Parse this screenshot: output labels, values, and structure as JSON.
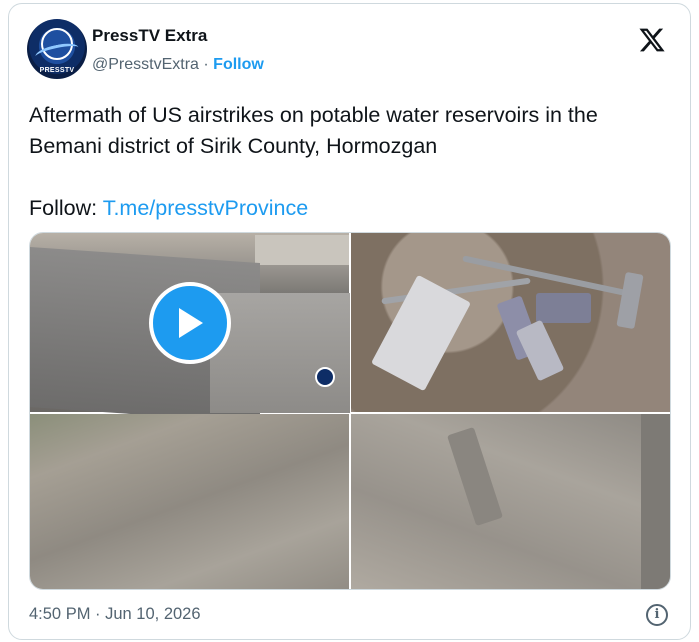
{
  "account": {
    "name": "PressTV Extra",
    "handle": "@PresstvExtra",
    "separator": "·",
    "follow_label": "Follow",
    "avatar_label": "PRESSTV"
  },
  "platform_icon": "x-logo-icon",
  "tweet": {
    "text_line": "Aftermath of US airstrikes on potable water reservoirs in the Bemani district of Sirik County, Hormozgan",
    "follow_prefix": "Follow: ",
    "follow_link": "T.me/presstvProvince"
  },
  "media": {
    "play_icon": "play-icon",
    "watermark_icon": "presstv-logo-icon"
  },
  "footer": {
    "timestamp": "4:50 PM · Jun 10, 2026",
    "info_icon": "info-icon",
    "info_glyph": "i"
  },
  "colors": {
    "accent": "#1d9bf0",
    "muted": "#536471",
    "text": "#0f1419",
    "border": "#cfd9de"
  }
}
